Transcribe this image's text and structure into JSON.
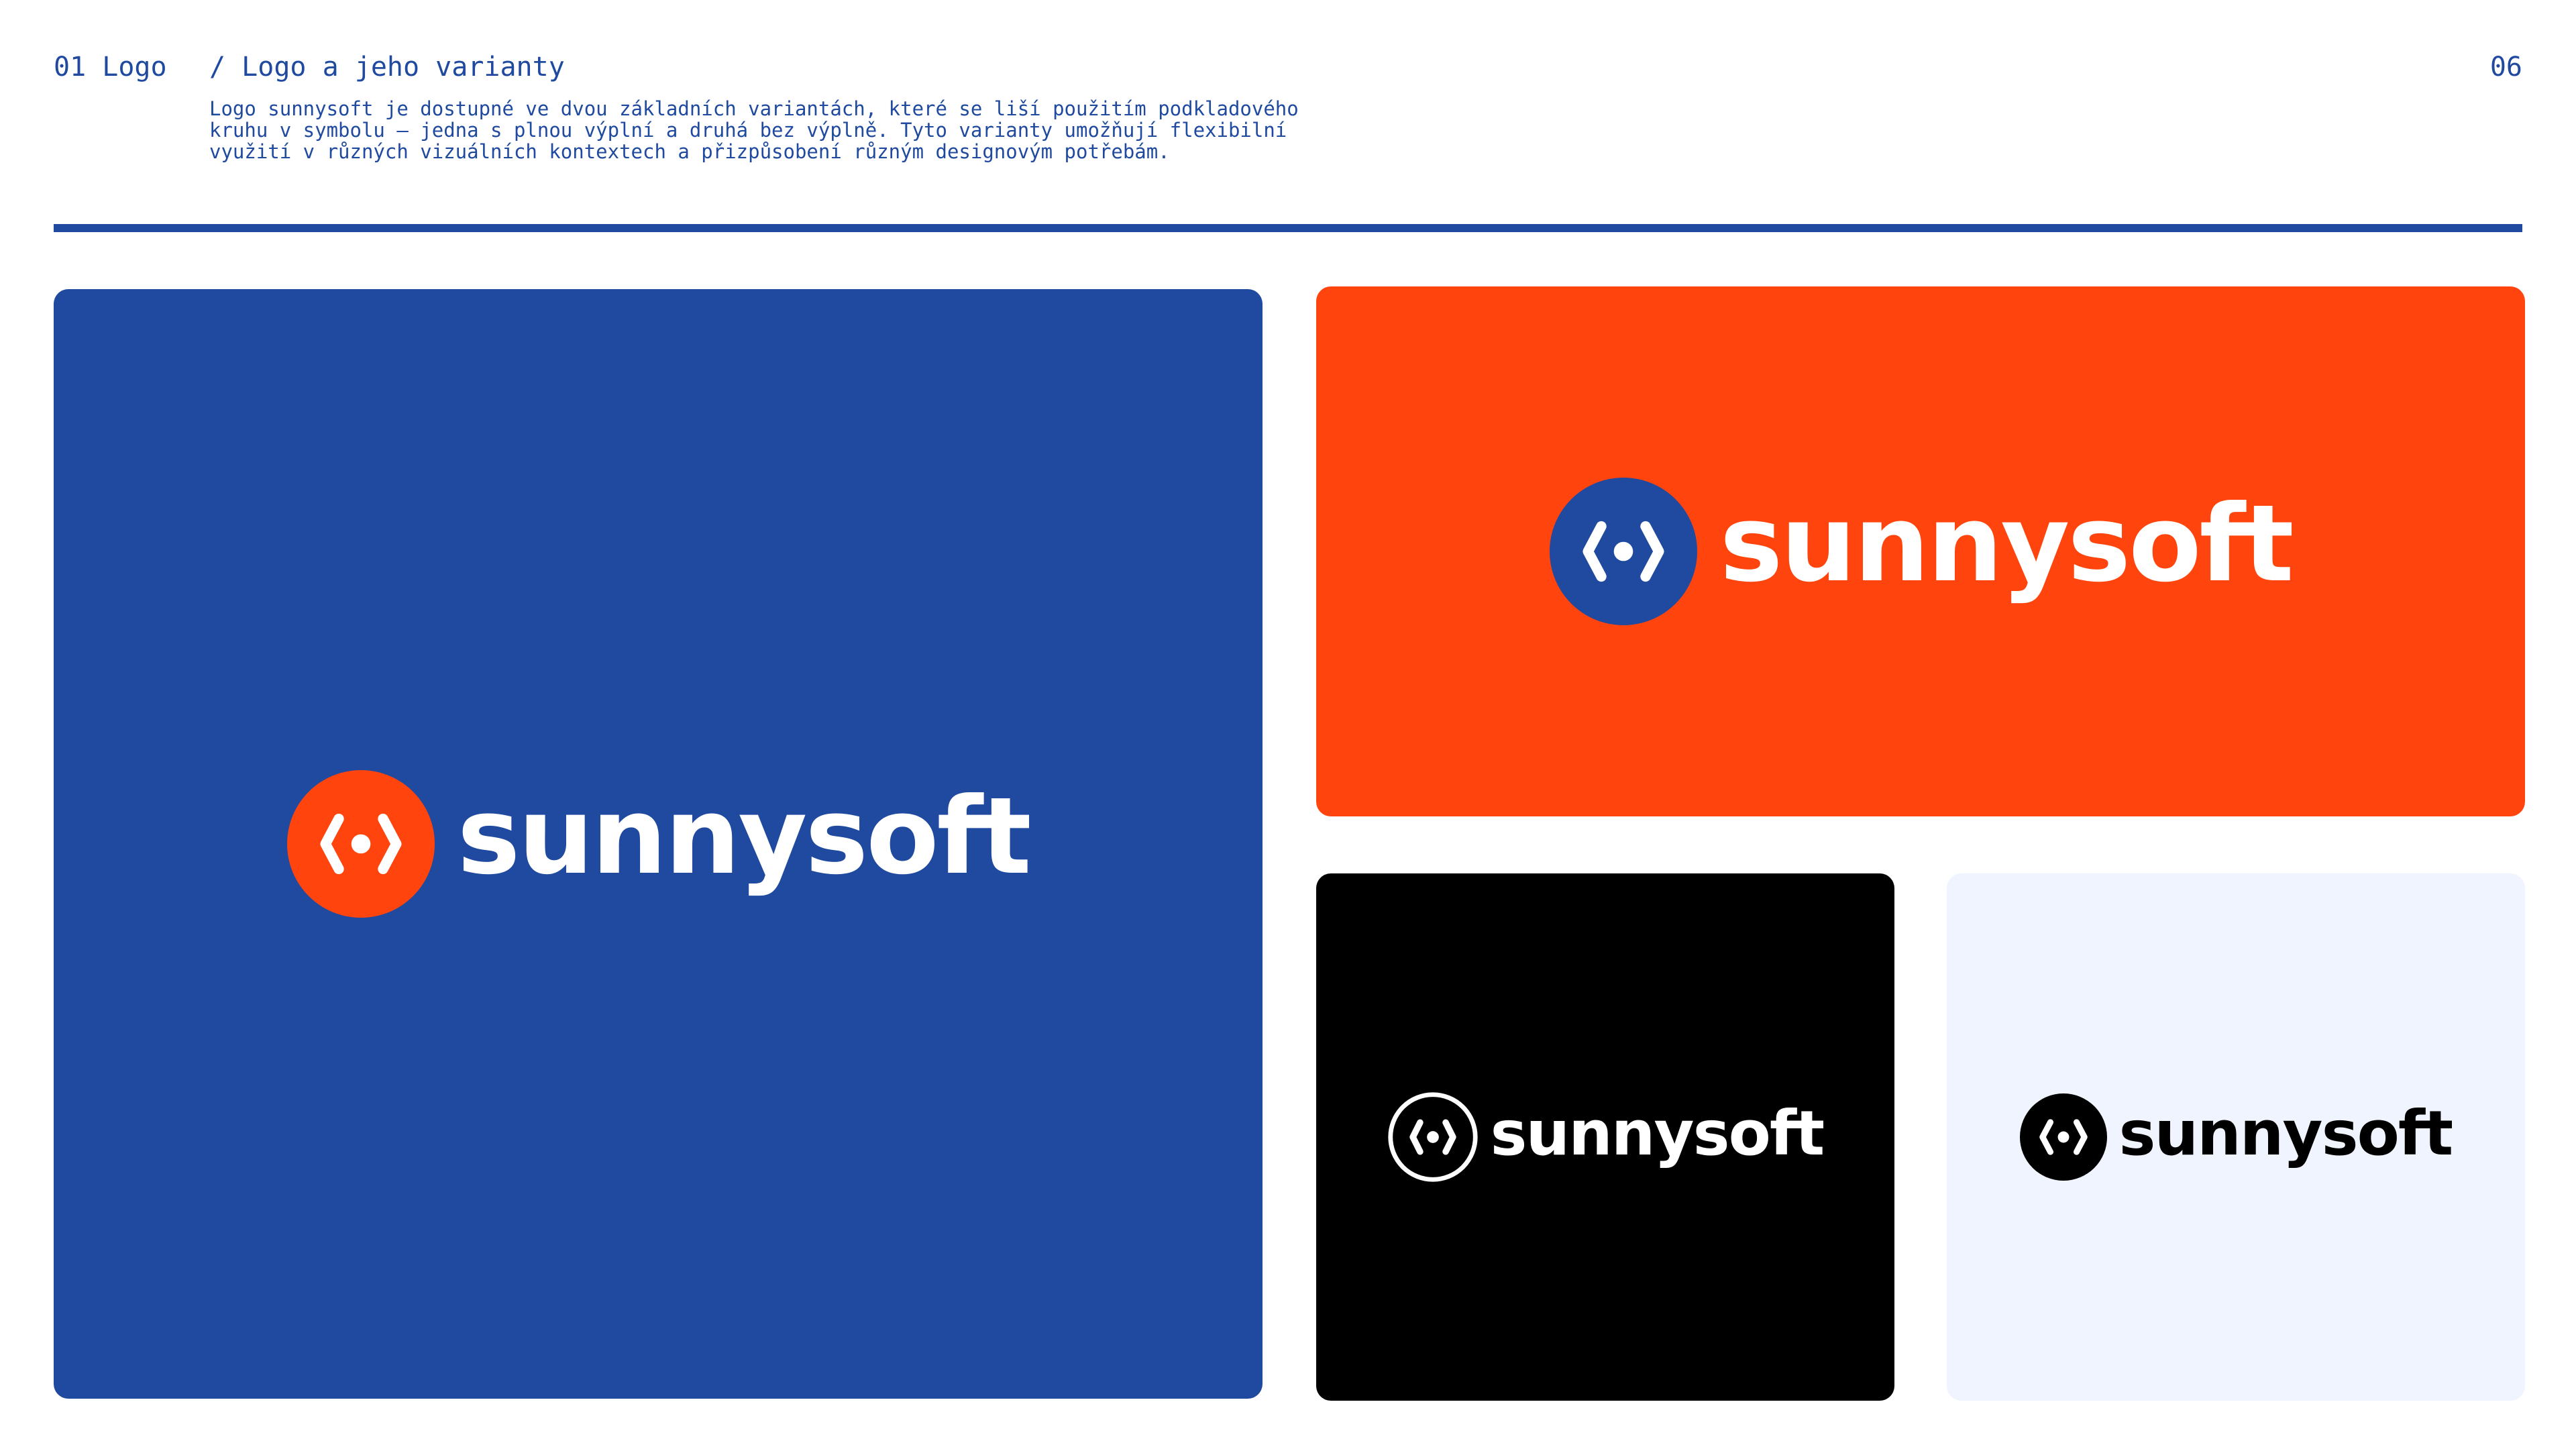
{
  "header": {
    "section_number": "01 Logo",
    "section_title": "/ Logo a jeho varianty",
    "page_number": "06",
    "description": "Logo sunnysoft je dostupné ve dvou základních variantách, které se liší použitím podkladového kruhu v symbolu – jedna s plnou výplní a druhá bez výplně. Tyto varianty umožňují flexibilní využití v různých vizuálních kontextech a přizpůsobení různým designovým potřebám."
  },
  "colors": {
    "brand_blue": "#1f4aa0",
    "brand_orange": "#ff450d",
    "black": "#000000",
    "light": "#eff4fe",
    "white": "#ffffff"
  },
  "variants": [
    {
      "wordmark": "sunnysoft",
      "background": "blue",
      "symbol": "filled orange circle",
      "icon": "sunnysoft-symbol-icon"
    },
    {
      "wordmark": "sunnysoft",
      "background": "orange",
      "symbol": "filled blue circle",
      "icon": "sunnysoft-symbol-icon"
    },
    {
      "wordmark": "sunnysoft",
      "background": "black",
      "symbol": "outlined white circle",
      "icon": "sunnysoft-symbol-outline-icon"
    },
    {
      "wordmark": "sunnysoft",
      "background": "light",
      "symbol": "filled black circle",
      "icon": "sunnysoft-symbol-icon"
    }
  ]
}
